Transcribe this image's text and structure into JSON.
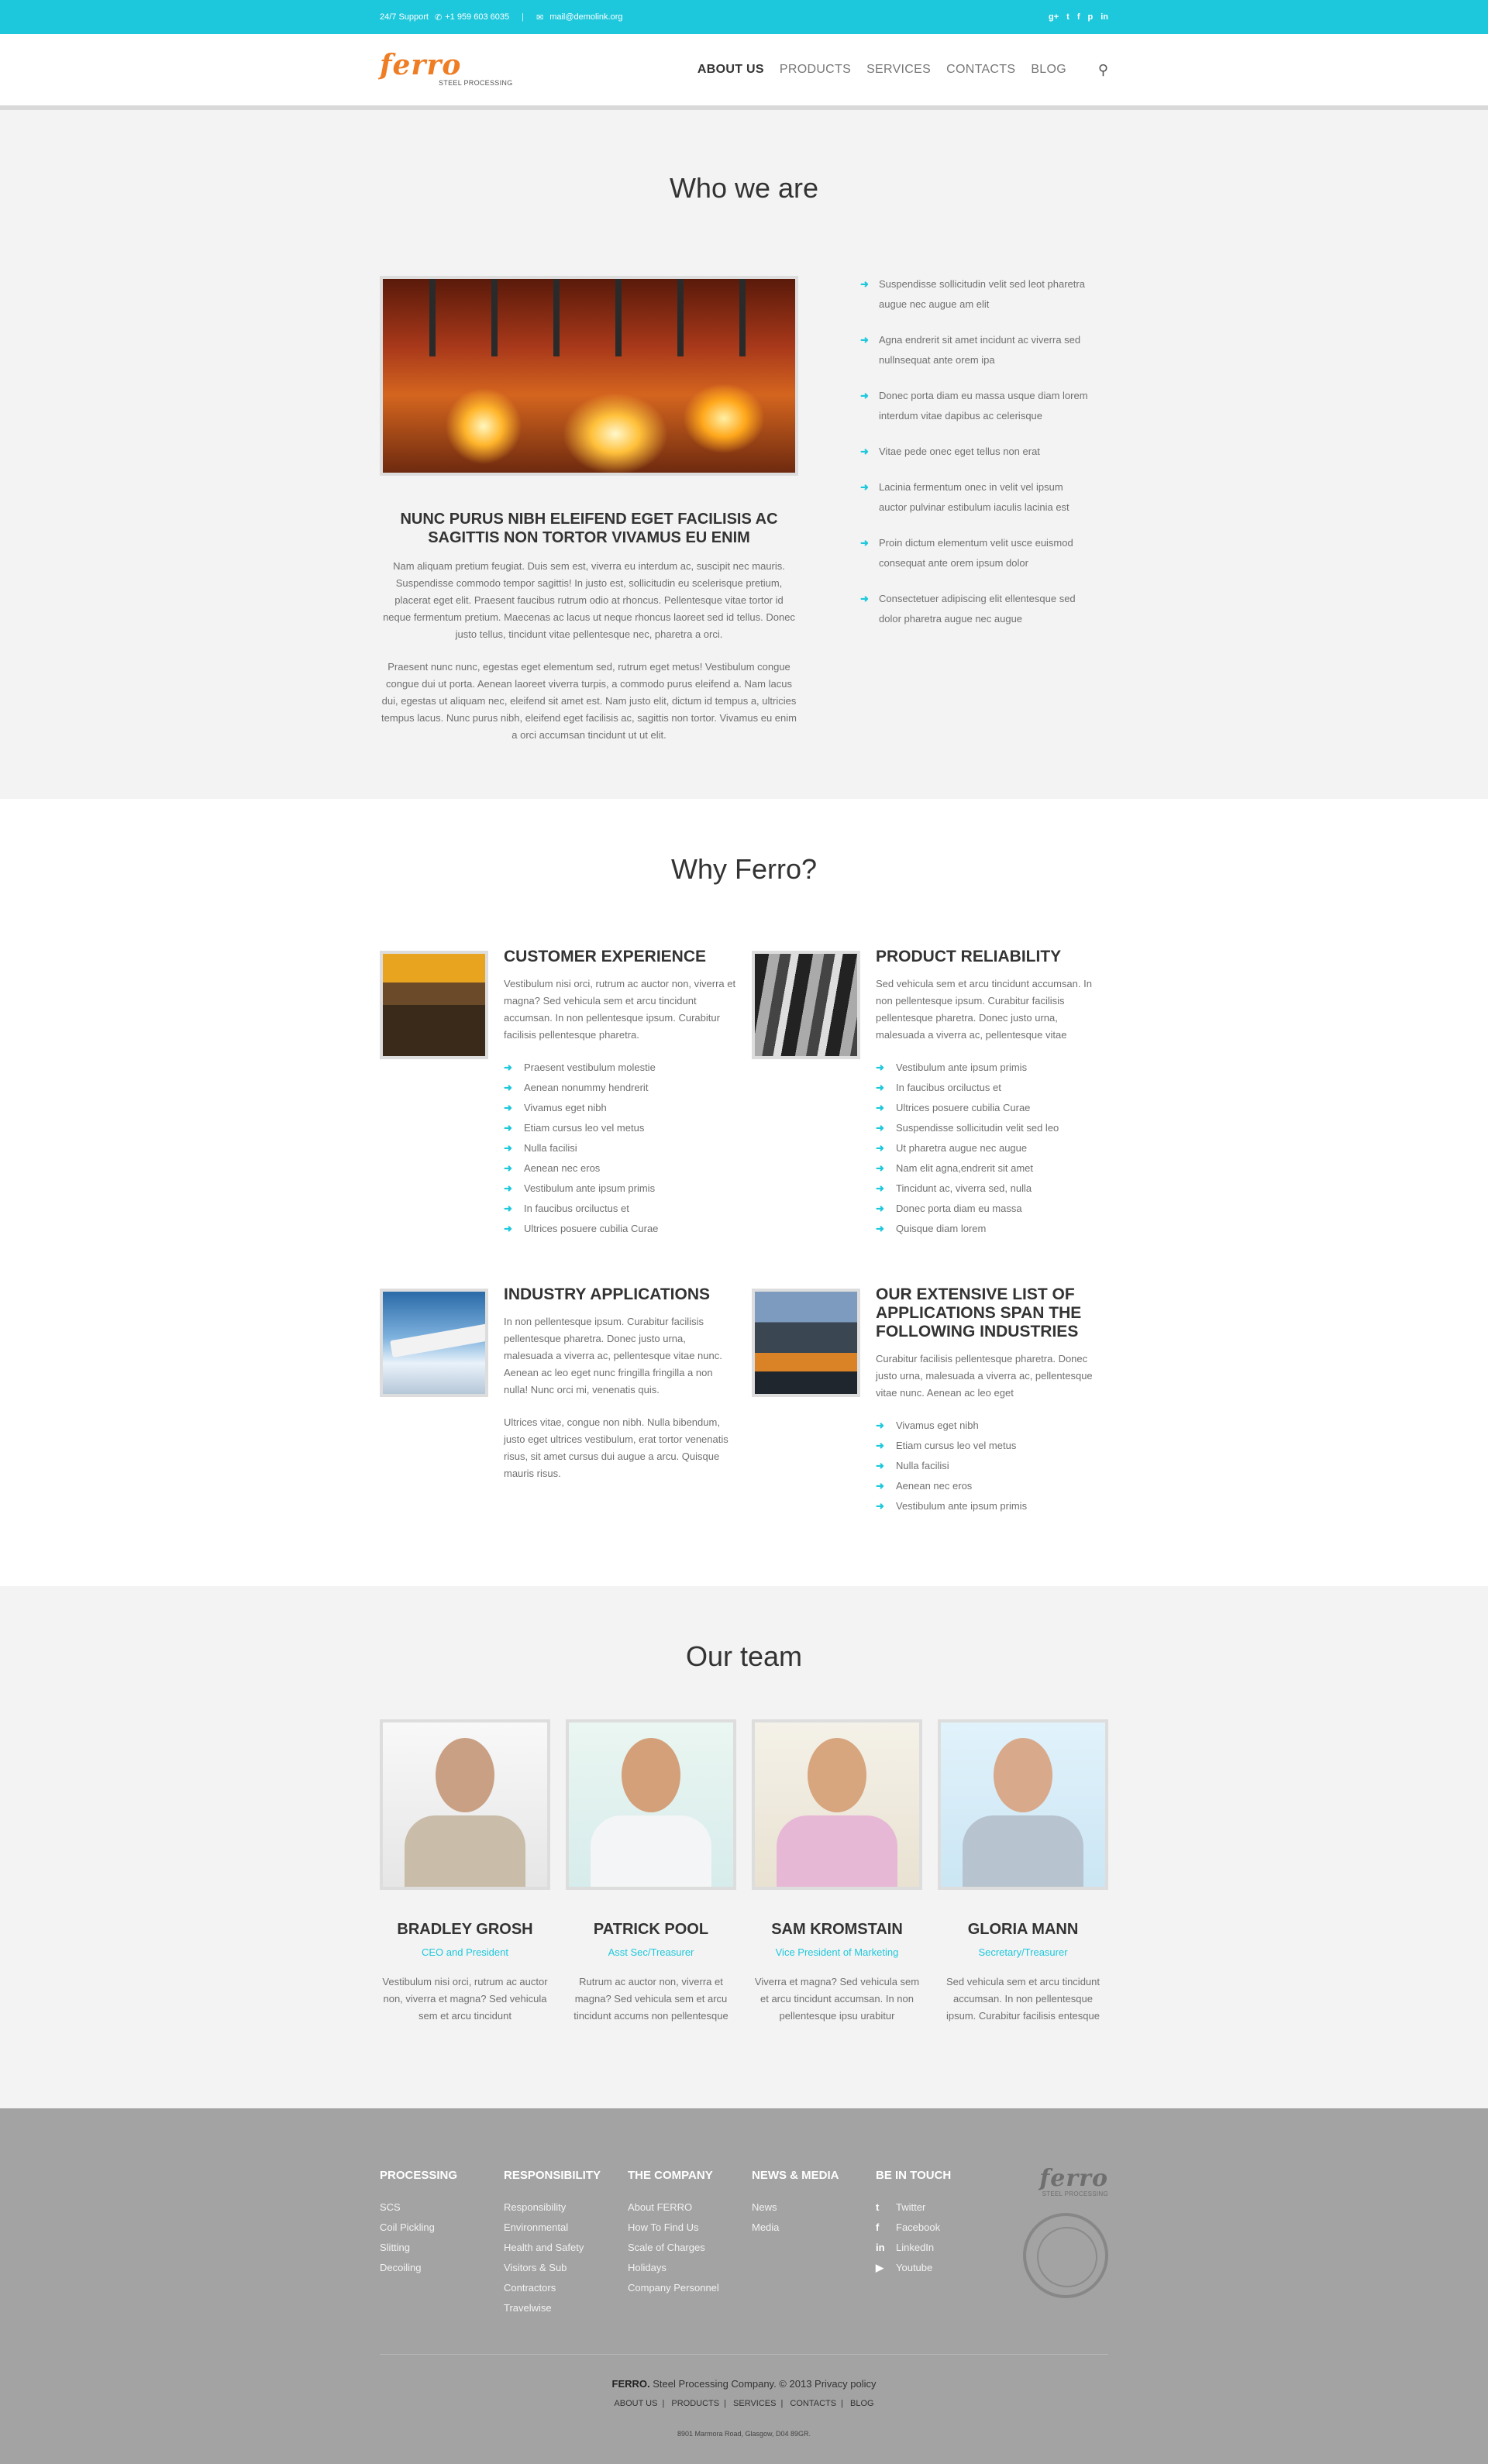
{
  "topbar": {
    "support_label": "24/7 Support",
    "phone": "+1 959 603 6035",
    "email": "mail@demolink.org",
    "socials": [
      "g+",
      "t",
      "f",
      "p",
      "in"
    ]
  },
  "header": {
    "logo_word": "ferro",
    "logo_sub": "STEEL PROCESSING",
    "nav": [
      "ABOUT US",
      "PRODUCTS",
      "SERVICES",
      "CONTACTS",
      "BLOG"
    ]
  },
  "who": {
    "title": "Who we are",
    "caption": "NUNC PURUS NIBH ELEIFEND EGET FACILISIS AC SAGITTIS NON TORTOR VIVAMUS EU ENIM",
    "para1": "Nam aliquam pretium feugiat. Duis sem est, viverra eu interdum ac, suscipit nec mauris. Suspendisse commodo tempor sagittis! In justo est, sollicitudin eu scelerisque pretium, placerat eget elit. Praesent faucibus rutrum odio at rhoncus. Pellentesque vitae tortor id neque fermentum pretium. Maecenas ac lacus ut neque rhoncus laoreet sed id tellus. Donec justo tellus, tincidunt vitae pellentesque nec, pharetra a orci.",
    "para2": "Praesent nunc nunc, egestas eget elementum sed, rutrum eget metus! Vestibulum congue congue dui ut porta. Aenean laoreet viverra turpis, a commodo purus eleifend a. Nam lacus dui, egestas ut aliquam nec, eleifend sit amet est. Nam justo elit, dictum id tempus a, ultricies tempus lacus. Nunc purus nibh, eleifend eget facilisis ac, sagittis non tortor. Vivamus eu enim a orci accumsan tincidunt ut ut elit.",
    "list": [
      "Suspendisse sollicitudin velit sed leot pharetra augue nec augue am elit",
      "Agna endrerit sit amet incidunt ac viverra sed nullnsequat ante orem ipa",
      "Donec porta diam eu massa usque diam lorem interdum vitae dapibus ac celerisque",
      "Vitae pede onec eget tellus non erat",
      "Lacinia fermentum onec in velit vel ipsum auctor pulvinar estibulum iaculis lacinia est",
      "Proin dictum elementum velit usce euismod consequat ante orem ipsum dolor",
      "Consectetuer adipiscing elit ellentesque sed dolor pharetra augue nec augue"
    ]
  },
  "why": {
    "title": "Why Ferro?",
    "features": [
      {
        "title": "CUSTOMER EXPERIENCE",
        "desc": [
          "Vestibulum nisi orci, rutrum ac auctor non, viverra et magna? Sed vehicula sem et arcu tincidunt accumsan. In non pellentesque ipsum. Curabitur facilisis pellentesque pharetra."
        ],
        "items": [
          "Praesent vestibulum molestie",
          "Aenean nonummy hendrerit",
          "Vivamus eget nibh",
          "Etiam cursus leo vel metus",
          "Nulla facilisi",
          "Aenean nec eros",
          "Vestibulum ante ipsum primis",
          "In faucibus orciluctus et",
          "Ultrices posuere cubilia Curae"
        ]
      },
      {
        "title": "PRODUCT RELIABILITY",
        "desc": [
          "Sed vehicula sem et arcu tincidunt accumsan. In non pellentesque ipsum. Curabitur facilisis pellentesque pharetra. Donec justo urna, malesuada a viverra ac, pellentesque vitae"
        ],
        "items": [
          "Vestibulum ante ipsum primis",
          "In faucibus orciluctus et",
          "Ultrices posuere cubilia Curae",
          "Suspendisse sollicitudin velit sed leo",
          "Ut pharetra augue nec augue",
          "Nam elit agna,endrerit sit amet",
          "Tincidunt ac, viverra sed, nulla",
          "Donec porta diam eu massa",
          "Quisque diam lorem"
        ]
      },
      {
        "title": "INDUSTRY APPLICATIONS",
        "desc": [
          "In non pellentesque ipsum. Curabitur facilisis pellentesque pharetra. Donec justo urna, malesuada a viverra ac, pellentesque vitae nunc. Aenean ac leo eget nunc fringilla fringilla a non nulla! Nunc orci mi, venenatis quis.",
          "Ultrices vitae, congue non nibh. Nulla bibendum, justo eget ultrices vestibulum, erat tortor venenatis risus, sit amet cursus dui augue a arcu. Quisque mauris risus."
        ],
        "items": []
      },
      {
        "title": "OUR EXTENSIVE LIST OF APPLICATIONS SPAN THE FOLLOWING INDUSTRIES",
        "desc": [
          "Curabitur facilisis pellentesque pharetra. Donec justo urna, malesuada a viverra ac, pellentesque vitae nunc. Aenean ac leo eget"
        ],
        "items": [
          "Vivamus eget nibh",
          "Etiam cursus leo vel metus",
          "Nulla facilisi",
          "Aenean nec eros",
          "Vestibulum ante ipsum primis"
        ]
      }
    ]
  },
  "team": {
    "title": "Our team",
    "members": [
      {
        "name": "BRADLEY GROSH",
        "role": "CEO and President",
        "bio": "Vestibulum nisi orci, rutrum ac auctor non, viverra et magna? Sed vehicula sem et arcu tincidunt"
      },
      {
        "name": "PATRICK POOL",
        "role": "Asst Sec/Treasurer",
        "bio": "Rutrum ac auctor non, viverra et magna? Sed vehicula sem et arcu tincidunt accums non pellentesque"
      },
      {
        "name": "SAM KROMSTAIN",
        "role": "Vice President of Marketing",
        "bio": "Viverra et magna? Sed vehicula sem et arcu tincidunt accumsan. In non pellentesque ipsu urabitur"
      },
      {
        "name": "GLORIA MANN",
        "role": "Secretary/Treasurer",
        "bio": "Sed vehicula sem et arcu tincidunt accumsan. In non pellentesque ipsum. Curabitur facilisis entesque"
      }
    ]
  },
  "footer": {
    "columns": [
      {
        "title": "PROCESSING",
        "links": [
          "SCS",
          "Coil Pickling",
          "Slitting",
          "Decoiling"
        ]
      },
      {
        "title": "RESPONSIBILITY",
        "links": [
          "Responsibility",
          "Environmental",
          "Health and Safety",
          "Visitors & Sub",
          "Contractors",
          "Travelwise"
        ]
      },
      {
        "title": "THE COMPANY",
        "links": [
          "About FERRO",
          "How To Find Us",
          "Scale of Charges",
          "Holidays",
          "Company Personnel"
        ]
      },
      {
        "title": "NEWS & MEDIA",
        "links": [
          "News",
          "Media"
        ]
      },
      {
        "title": "BE IN TOUCH",
        "links": [
          "Twitter",
          "Facebook",
          "LinkedIn",
          "Youtube"
        ]
      }
    ],
    "brand": "ferro",
    "brand_sub": "STEEL PROCESSING",
    "copyright_brand": "FERRO.",
    "copyright_text": "Steel Processing Company. © 2013 Privacy policy",
    "nav": [
      "ABOUT US",
      "PRODUCTS",
      "SERVICES",
      "CONTACTS",
      "BLOG"
    ],
    "address": "8901 Marmora Road, Glasgow, D04 89GR."
  }
}
